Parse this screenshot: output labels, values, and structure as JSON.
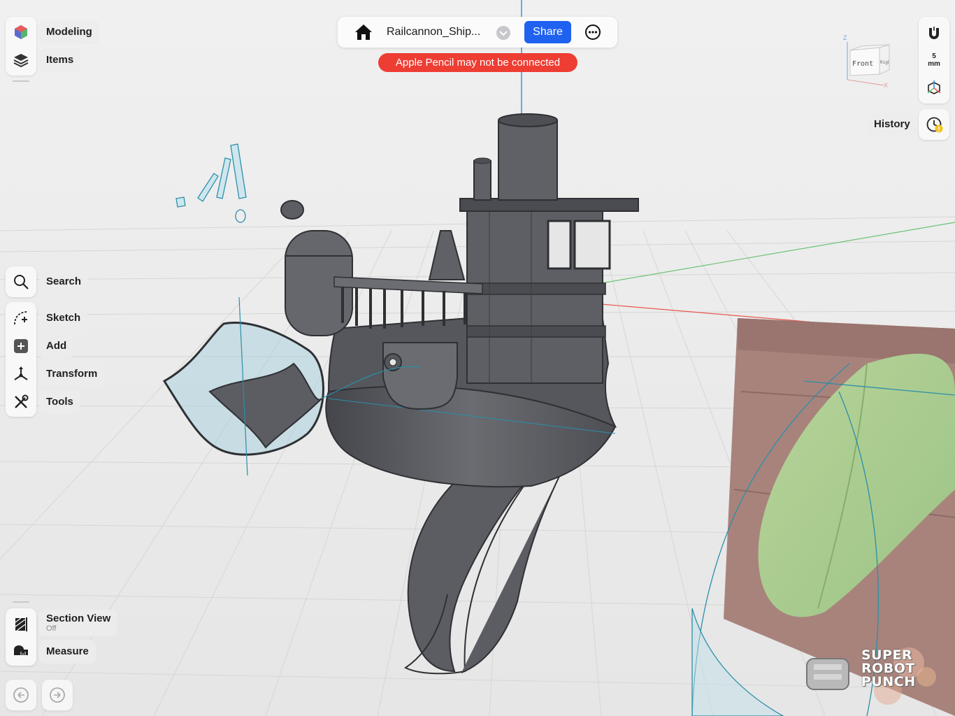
{
  "workspace": {
    "mode_label": "Modeling",
    "items_label": "Items"
  },
  "document": {
    "title": "Railcannon_Ship...",
    "share_label": "Share"
  },
  "warning": {
    "text": "Apple Pencil may not be connected"
  },
  "tools": {
    "search_label": "Search",
    "sketch_label": "Sketch",
    "add_label": "Add",
    "transform_label": "Transform",
    "tools_label": "Tools"
  },
  "bottom": {
    "section_view_label": "Section View",
    "section_view_state": "Off",
    "measure_label": "Measure"
  },
  "right_panel": {
    "grid_value": "5",
    "grid_unit": "mm",
    "history_label": "History",
    "view_cube_front": "Front",
    "view_cube_right": "Right",
    "axis_z": "Z",
    "axis_x": "X"
  },
  "watermark": {
    "line1": "SUPER",
    "line2": "ROBOT",
    "line3": "PUNCH"
  },
  "colors": {
    "accent": "#1f62f0",
    "warning": "#ee3d33",
    "model": "#5b5d62",
    "sketch_lines": "#2b8fa8",
    "axis_x": "#e8584f",
    "axis_y": "#6cc275",
    "axis_z": "#3d8fe0"
  }
}
